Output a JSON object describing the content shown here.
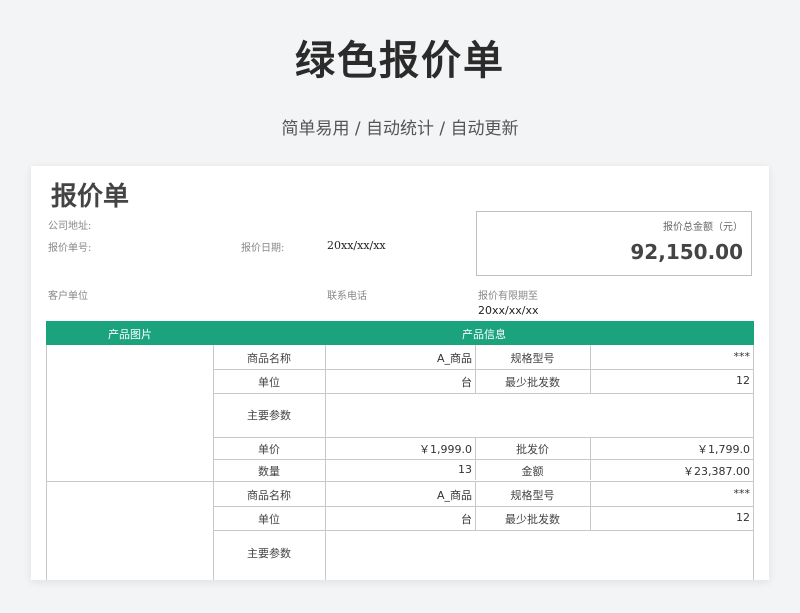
{
  "hero": {
    "title": "绿色报价单",
    "subtitle": "简单易用 / 自动统计 / 自动更新"
  },
  "sheet": {
    "title": "报价单",
    "company_address_label": "公司地址:",
    "quote_no_label": "报价单号:",
    "quote_date_label": "报价日期:",
    "quote_date_value": "20xx/xx/xx",
    "customer_label": "客户单位",
    "phone_label": "联系电话",
    "valid_until_label": "报价有限期至",
    "valid_until_value": "20xx/xx/xx",
    "total_label": "报价总金额（元）",
    "total_value": "92,150.00"
  },
  "table": {
    "header_image": "产品图片",
    "header_info": "产品信息",
    "products": [
      {
        "name_label": "商品名称",
        "name": "A_商品",
        "spec_label": "规格型号",
        "spec": "***",
        "unit_label": "单位",
        "unit": "台",
        "min_label": "最少批发数",
        "min": "12",
        "params_label": "主要参数",
        "price_label": "单价",
        "price": "￥1,999.0",
        "wholesale_label": "批发价",
        "wholesale": "￥1,799.0",
        "qty_label": "数量",
        "qty": "13",
        "amount_label": "金额",
        "amount": "￥23,387.00"
      },
      {
        "name_label": "商品名称",
        "name": "A_商品",
        "spec_label": "规格型号",
        "spec": "***",
        "unit_label": "单位",
        "unit": "台",
        "min_label": "最少批发数",
        "min": "12",
        "params_label": "主要参数"
      }
    ]
  }
}
